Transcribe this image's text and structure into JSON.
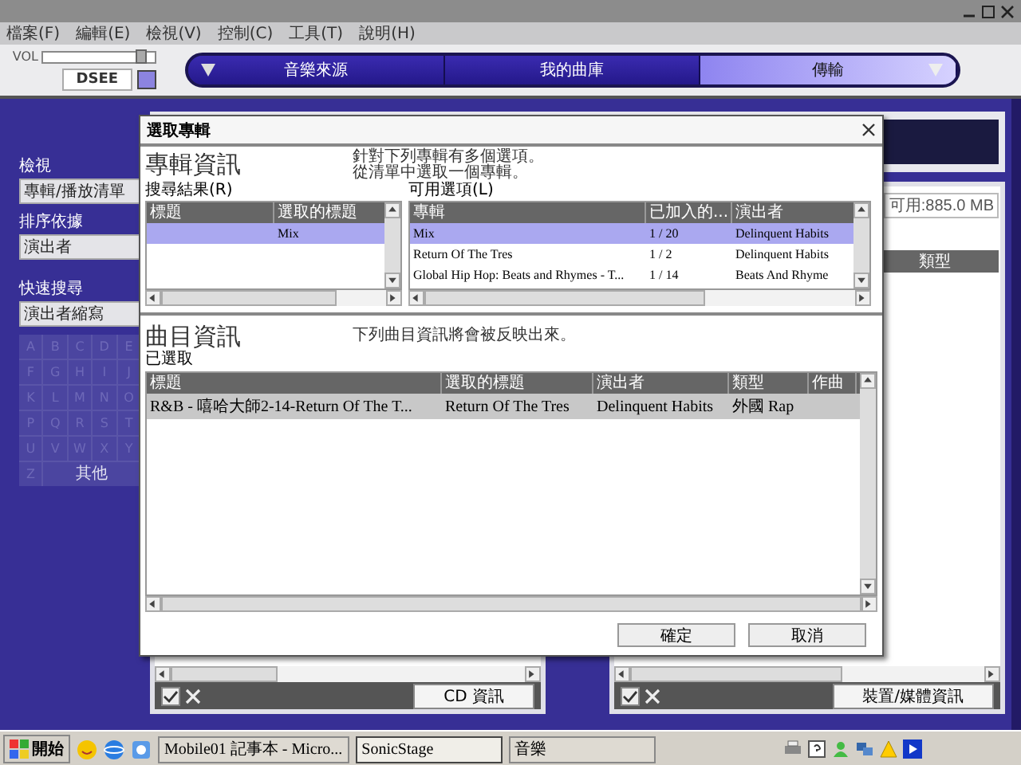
{
  "menu": [
    "檔案(F)",
    "編輯(E)",
    "檢視(V)",
    "控制(C)",
    "工具(T)",
    "說明(H)"
  ],
  "volume": {
    "label": "VOL",
    "level": 0.88
  },
  "dsee_button": "DSEE",
  "nav_tabs": [
    {
      "label": "音樂來源",
      "selected": false
    },
    {
      "label": "我的曲庫",
      "selected": false
    },
    {
      "label": "傳輸",
      "selected": true
    }
  ],
  "left_panel": {
    "view_label": "檢視",
    "view_value": "專輯/播放清單",
    "sort_label": "排序依據",
    "sort_value": "演出者",
    "quick_label": "快速搜尋",
    "quick_value": "演出者縮寫",
    "letters": [
      "A",
      "B",
      "C",
      "D",
      "E",
      "F",
      "G",
      "H",
      "I",
      "J",
      "K",
      "L",
      "M",
      "N",
      "O",
      "P",
      "Q",
      "R",
      "S",
      "T",
      "U",
      "V",
      "W",
      "X",
      "Y",
      "Z"
    ],
    "other_key": "其他"
  },
  "capacity": "可用:885.0 MB",
  "right_column_header": "類型",
  "cd_info_button": "CD 資訊",
  "device_info_button": "裝置/媒體資訊",
  "dialog": {
    "title": "選取專輯",
    "album_section": {
      "heading": "專輯資訊",
      "note": [
        "針對下列專輯有多個選項。",
        "從清單中選取一個專輯。"
      ],
      "results": {
        "label": "搜尋結果(R)",
        "columns": [
          "標題",
          "選取的標題"
        ],
        "rows": [
          {
            "cells": [
              "",
              "Mix"
            ],
            "selected": true
          }
        ]
      },
      "options": {
        "label": "可用選項(L)",
        "columns": [
          "專輯",
          "已加入的...",
          "演出者"
        ],
        "rows": [
          {
            "cells": [
              "Mix",
              "1 / 20",
              "Delinquent Habits"
            ],
            "selected": true
          },
          {
            "cells": [
              "Return Of The Tres",
              "1 / 2",
              "Delinquent Habits"
            ],
            "selected": false
          },
          {
            "cells": [
              "Global Hip Hop: Beats and Rhymes - T...",
              "1 / 14",
              "Beats And Rhyme"
            ],
            "selected": false
          }
        ]
      }
    },
    "track_section": {
      "heading": "曲目資訊",
      "note": "下列曲目資訊將會被反映出來。",
      "label": "已選取",
      "columns": [
        "標題",
        "選取的標題",
        "演出者",
        "類型",
        "作曲"
      ],
      "rows": [
        {
          "cells": [
            "R&B - 嘻哈大師2-14-Return Of The T...",
            "Return Of The Tres",
            "Delinquent Habits",
            "外國 Rap",
            ""
          ],
          "selected": true
        }
      ]
    },
    "buttons": [
      "確定",
      "取消"
    ]
  },
  "taskbar": {
    "start": "開始",
    "tasks": [
      {
        "label": "Mobile01 記事本 - Micro...",
        "selected": false
      },
      {
        "label": "SonicStage",
        "selected": true
      },
      {
        "label": "音樂",
        "selected": false
      }
    ]
  }
}
